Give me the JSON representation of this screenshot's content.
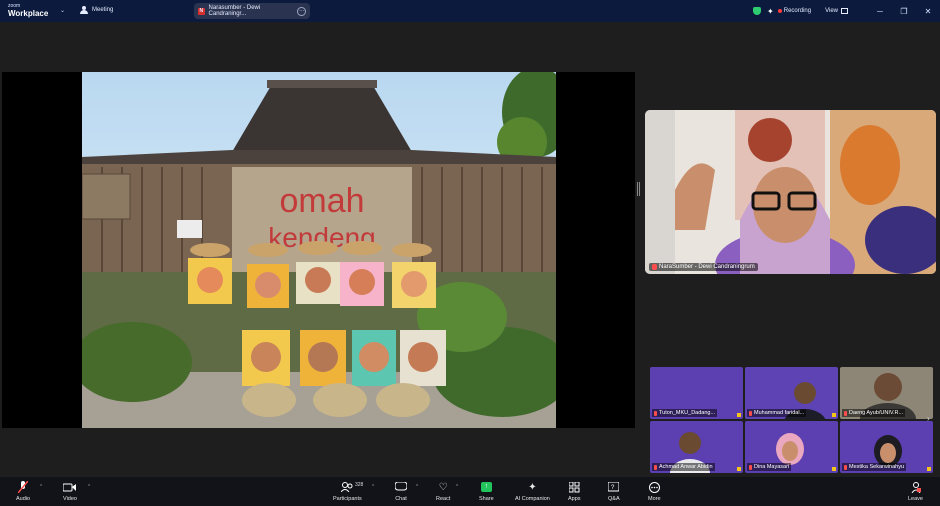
{
  "titlebar": {
    "logo_top": "zoom",
    "logo_bottom": "Workplace",
    "meeting_label": "Meeting",
    "share_tab_label": "Narasumber - Dewi Candraningr...",
    "recording_label": "Recording",
    "view_label": "View"
  },
  "speaker": {
    "name": "NaraSumber - Dewi Candraningrum"
  },
  "gallery": [
    {
      "name": "Tuton_MKU_Dadang..."
    },
    {
      "name": "Muhammad faridal..."
    },
    {
      "name": "Daeng Ayub/UNIV.R..."
    },
    {
      "name": "Achmad Anwar Abidin"
    },
    {
      "name": "Dina Mayasari"
    },
    {
      "name": "Mestika Sekarwinahyu"
    }
  ],
  "toolbar": {
    "audio": "Audio",
    "video": "Video",
    "participants": "Participants",
    "participants_count": "328",
    "chat": "Chat",
    "react": "React",
    "share": "Share",
    "ai_companion": "AI Companion",
    "apps": "Apps",
    "qa": "Q&A",
    "more": "More",
    "leave": "Leave"
  },
  "photo": {
    "sign_line1": "omah",
    "sign_line2": "kendeng"
  },
  "colors": {
    "titlebar": "#0b1a3d",
    "toolbar": "#111318",
    "recording_dot": "#ff3b3b",
    "share_green": "#21c45d",
    "tile_purple": "#5c3fb0"
  }
}
